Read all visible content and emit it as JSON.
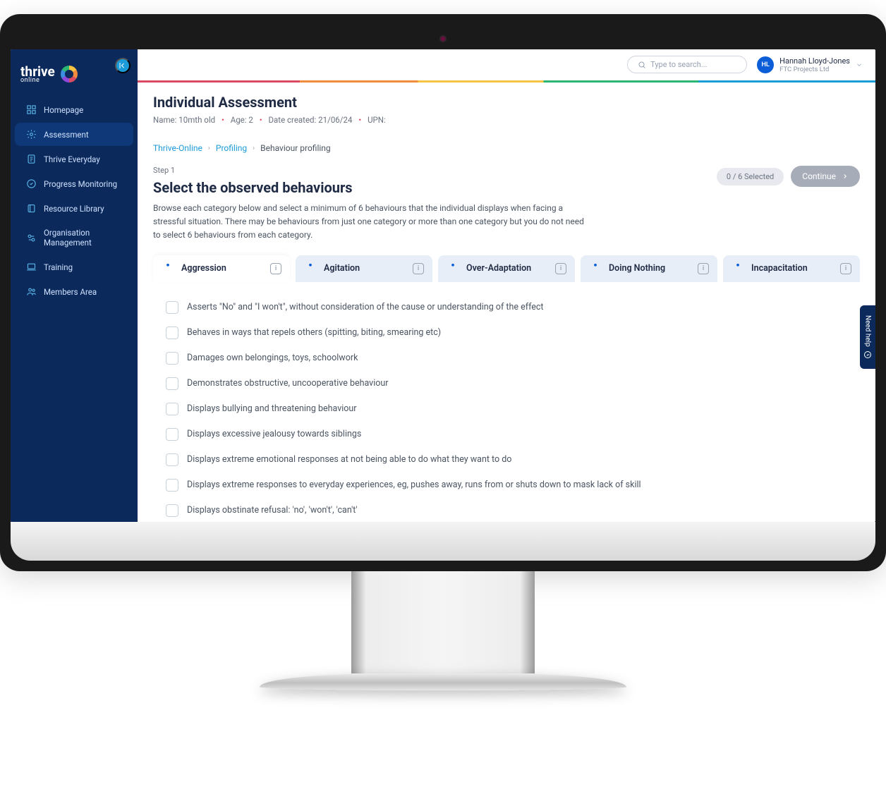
{
  "logo": {
    "name": "thrive",
    "sub": "online"
  },
  "sidebar": {
    "items": [
      {
        "icon": "grid",
        "label": "Homepage"
      },
      {
        "icon": "gear",
        "label": "Assessment",
        "active": true
      },
      {
        "icon": "doc",
        "label": "Thrive Everyday"
      },
      {
        "icon": "target",
        "label": "Progress Monitoring"
      },
      {
        "icon": "book",
        "label": "Resource Library"
      },
      {
        "icon": "org",
        "label": "Organisation Management"
      },
      {
        "icon": "laptop",
        "label": "Training"
      },
      {
        "icon": "users",
        "label": "Members Area"
      }
    ]
  },
  "search": {
    "placeholder": "Type to search..."
  },
  "user": {
    "initials": "HL",
    "name": "Hannah Lloyd-Jones",
    "org": "FTC Projects Ltd"
  },
  "page": {
    "title": "Individual Assessment",
    "meta": {
      "name_label": "Name:",
      "name": "10mth old",
      "age_label": "Age:",
      "age": "2",
      "date_label": "Date created:",
      "date": "21/06/24",
      "upn_label": "UPN:",
      "upn": ""
    },
    "crumbs": [
      "Thrive-Online",
      "Profiling",
      "Behaviour profiling"
    ],
    "step": "Step 1",
    "heading": "Select the observed behaviours",
    "description": "Browse each category below and select a minimum of 6 behaviours that the individual displays when facing a stressful situation. There may be behaviours from just one category or more than one category but you do not need to select 6 behaviours from each category.",
    "selected_count": "0 / 6 Selected",
    "continue": "Continue",
    "tabs": [
      "Aggression",
      "Agitation",
      "Over-Adaptation",
      "Doing Nothing",
      "Incapacitation"
    ],
    "behaviours": [
      "Asserts \"No\" and \"I won't\", without consideration of the cause or understanding of the effect",
      "Behaves in ways that repels others (spitting, biting, smearing etc)",
      "Damages own belongings, toys, schoolwork",
      "Demonstrates obstructive, uncooperative behaviour",
      "Displays bullying and threatening behaviour",
      "Displays excessive jealousy towards siblings",
      "Displays extreme emotional responses at not being able to do what they want to do",
      "Displays extreme responses to everyday experiences, eg, pushes away, runs from or shuts down to mask lack of skill",
      "Displays obstinate refusal: 'no', 'won't', 'can't'",
      "Demonstrates obstructive, uncooperative behaviour"
    ]
  },
  "help": "Need help"
}
